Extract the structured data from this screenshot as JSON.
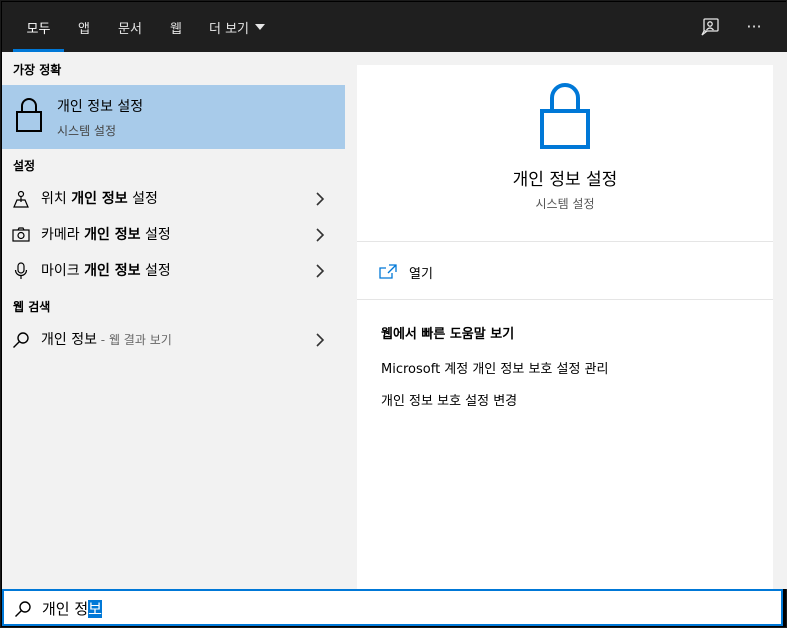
{
  "tabs": [
    {
      "label": "모두"
    },
    {
      "label": "앱"
    },
    {
      "label": "문서"
    },
    {
      "label": "웹"
    },
    {
      "label": "더 보기"
    }
  ],
  "topbar_icons": [
    "feedback-icon",
    "more-options-icon"
  ],
  "more_glyph": "···",
  "sections": {
    "best_match": "가장 정확",
    "settings": "설정",
    "web_search": "웹 검색"
  },
  "best_match": {
    "title": "개인 정보 설정",
    "subtitle": "시스템 설정"
  },
  "settings_items": [
    {
      "pre": "위치 ",
      "bold": "개인 정보",
      "post": " 설정",
      "icon": "location-icon"
    },
    {
      "pre": "카메라 ",
      "bold": "개인 정보",
      "post": " 설정",
      "icon": "camera-icon"
    },
    {
      "pre": "마이크 ",
      "bold": "개인 정보",
      "post": " 설정",
      "icon": "microphone-icon"
    }
  ],
  "web_item": {
    "query": "개인 정보",
    "suffix": " - 웹 결과 보기"
  },
  "preview": {
    "title": "개인 정보 설정",
    "subtitle": "시스템 설정",
    "open_label": "열기",
    "web_help_header": "웹에서 빠른 도움말 보기",
    "web_links": [
      "Microsoft 계정 개인 정보 보호 설정 관리",
      "개인 정보 보호 설정 변경"
    ]
  },
  "search": {
    "value_plain": "개인 정",
    "value_selected": "보"
  },
  "colors": {
    "accent": "#0078d7",
    "selected_row": "#a8cbea",
    "topbar": "#1f1f1f",
    "panel": "#f2f2f2"
  }
}
